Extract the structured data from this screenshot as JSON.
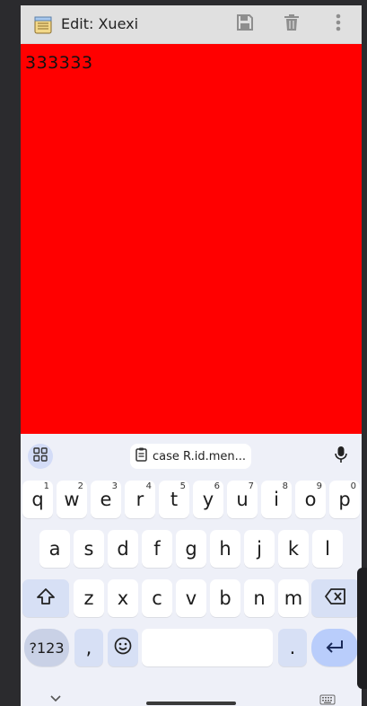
{
  "titlebar": {
    "title": "Edit: Xuexi",
    "icons": [
      "notepad-app-icon",
      "save-icon",
      "delete-icon",
      "more-vert-icon"
    ]
  },
  "editor": {
    "text": "333333",
    "background": "#ff0000"
  },
  "keyboard": {
    "suggestion_bar": {
      "clipboard_chip": "case R.id.men...",
      "icons": [
        "apps-grid-icon",
        "clipboard-icon",
        "mic-icon"
      ]
    },
    "row1": [
      {
        "key": "q",
        "hint": "1"
      },
      {
        "key": "w",
        "hint": "2"
      },
      {
        "key": "e",
        "hint": "3"
      },
      {
        "key": "r",
        "hint": "4"
      },
      {
        "key": "t",
        "hint": "5"
      },
      {
        "key": "y",
        "hint": "6"
      },
      {
        "key": "u",
        "hint": "7"
      },
      {
        "key": "i",
        "hint": "8"
      },
      {
        "key": "o",
        "hint": "9"
      },
      {
        "key": "p",
        "hint": "0"
      }
    ],
    "row2": [
      "a",
      "s",
      "d",
      "f",
      "g",
      "h",
      "j",
      "k",
      "l"
    ],
    "row3": [
      "z",
      "x",
      "c",
      "v",
      "b",
      "n",
      "m"
    ],
    "row4": {
      "symbols": "?123",
      "comma": ",",
      "period": "."
    },
    "colors": {
      "background": "#eef0f8",
      "key": "#ffffff",
      "function_key": "#d7e0f5",
      "enter_key": "#b9cdfb"
    }
  }
}
